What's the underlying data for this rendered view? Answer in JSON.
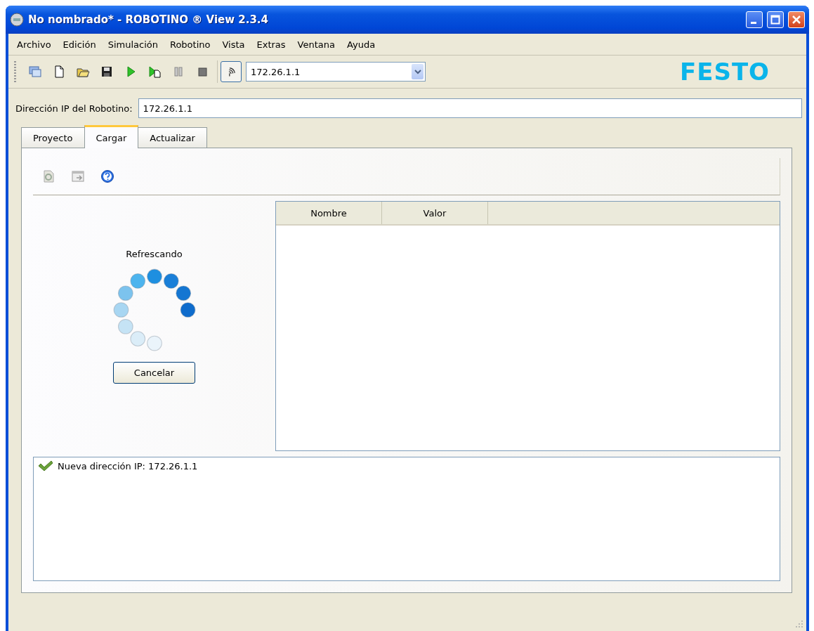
{
  "window": {
    "title": "No nombrado* - ROBOTINO ® View 2.3.4"
  },
  "menu": [
    "Archivo",
    "Edición",
    "Simulación",
    "Robotino",
    "Vista",
    "Extras",
    "Ventana",
    "Ayuda"
  ],
  "toolbar": {
    "address": "172.26.1.1",
    "logo": "FESTO"
  },
  "ip_field": {
    "label": "Dirección IP del Robotino:",
    "value": "172.26.1.1"
  },
  "tabs": [
    {
      "label": "Proyecto",
      "selected": false
    },
    {
      "label": "Cargar",
      "selected": true
    },
    {
      "label": "Actualizar",
      "selected": false
    }
  ],
  "progress": {
    "label": "Refrescando",
    "button": "Cancelar"
  },
  "table": {
    "columns": [
      "Nombre",
      "Valor"
    ]
  },
  "log": [
    {
      "kind": "success",
      "text": "Nueva dirección IP: 172.26.1.1"
    }
  ]
}
